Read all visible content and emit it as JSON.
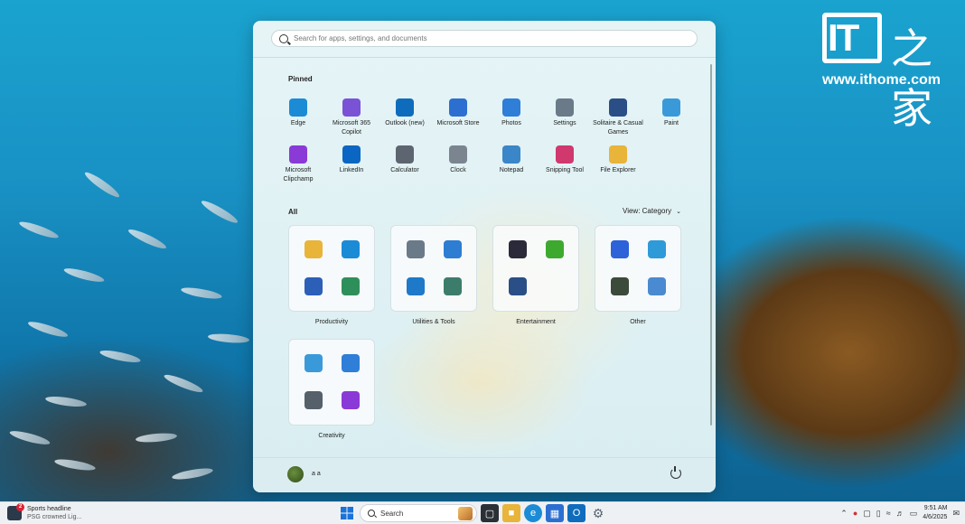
{
  "watermark": {
    "logo_it": "IT",
    "logo_chinese": "之家",
    "url": "www.ithome.com"
  },
  "start_menu": {
    "search_placeholder": "Search for apps, settings, and documents",
    "pinned_label": "Pinned",
    "pinned": [
      {
        "label": "Edge",
        "icon": "edge-icon",
        "color": "#1b8bd6"
      },
      {
        "label": "Microsoft 365 Copilot",
        "icon": "copilot-icon",
        "color": "#7a52d6"
      },
      {
        "label": "Outlook (new)",
        "icon": "outlook-icon",
        "color": "#0f6cbd"
      },
      {
        "label": "Microsoft Store",
        "icon": "store-icon",
        "color": "#2c6fd1"
      },
      {
        "label": "Photos",
        "icon": "photos-icon",
        "color": "#2f7ed8"
      },
      {
        "label": "Settings",
        "icon": "gear-icon",
        "color": "#6b7a89"
      },
      {
        "label": "Solitaire & Casual Games",
        "icon": "cards-icon",
        "color": "#2a4f86"
      },
      {
        "label": "Paint",
        "icon": "paint-icon",
        "color": "#3a9ad9"
      },
      {
        "label": "Microsoft Clipchamp",
        "icon": "clipchamp-icon",
        "color": "#8a3ad6"
      },
      {
        "label": "LinkedIn",
        "icon": "linkedin-icon",
        "color": "#0a66c2"
      },
      {
        "label": "Calculator",
        "icon": "calculator-icon",
        "color": "#5d6670"
      },
      {
        "label": "Clock",
        "icon": "clock-icon",
        "color": "#7b8590"
      },
      {
        "label": "Notepad",
        "icon": "notepad-icon",
        "color": "#3a86c8"
      },
      {
        "label": "Snipping Tool",
        "icon": "snipping-icon",
        "color": "#d0386e"
      },
      {
        "label": "File Explorer",
        "icon": "folder-icon",
        "color": "#e9b43a"
      }
    ],
    "all_label": "All",
    "view_label": "View: Category",
    "categories": [
      {
        "label": "Productivity",
        "icons": [
          {
            "name": "folder-icon",
            "color": "#e9b43a"
          },
          {
            "name": "edge-icon",
            "color": "#1b8bd6"
          },
          {
            "name": "word-icon",
            "color": "#2b5fb8"
          },
          {
            "name": "office-apps-icon",
            "color": "#2f8f5b"
          }
        ]
      },
      {
        "label": "Utilities & Tools",
        "icons": [
          {
            "name": "gear-icon",
            "color": "#6b7a89"
          },
          {
            "name": "people-icon",
            "color": "#2d7dd2"
          },
          {
            "name": "remote-desktop-icon",
            "color": "#1f79c9"
          },
          {
            "name": "tools-icon",
            "color": "#3b7d6a"
          }
        ]
      },
      {
        "label": "Entertainment",
        "icons": [
          {
            "name": "media-player-icon",
            "color": "#2a2a3a"
          },
          {
            "name": "xbox-game-icon",
            "color": "#3ea92f"
          },
          {
            "name": "cards-icon",
            "color": "#2a4f86"
          }
        ]
      },
      {
        "label": "Other",
        "icons": [
          {
            "name": "power-automate-icon",
            "color": "#2d62d8"
          },
          {
            "name": "image-pro-icon",
            "color": "#2f9ad8"
          },
          {
            "name": "terminal-icon",
            "color": "#3b4a3a"
          },
          {
            "name": "accessibility-icon",
            "color": "#4a8ad0"
          }
        ]
      },
      {
        "label": "Creativity",
        "icons": [
          {
            "name": "paint-icon",
            "color": "#3a9ad9"
          },
          {
            "name": "photos-icon",
            "color": "#2f7ed8"
          },
          {
            "name": "camera-icon",
            "color": "#55606b"
          },
          {
            "name": "clipchamp-icon",
            "color": "#8a3ad6"
          }
        ]
      }
    ],
    "user_name": "a a"
  },
  "taskbar": {
    "widget_badge": "2",
    "widget_title": "Sports headline",
    "widget_subtitle": "PSG crowned Lig...",
    "search_label": "Search",
    "time": "9:51 AM",
    "date": "4/6/2025"
  }
}
